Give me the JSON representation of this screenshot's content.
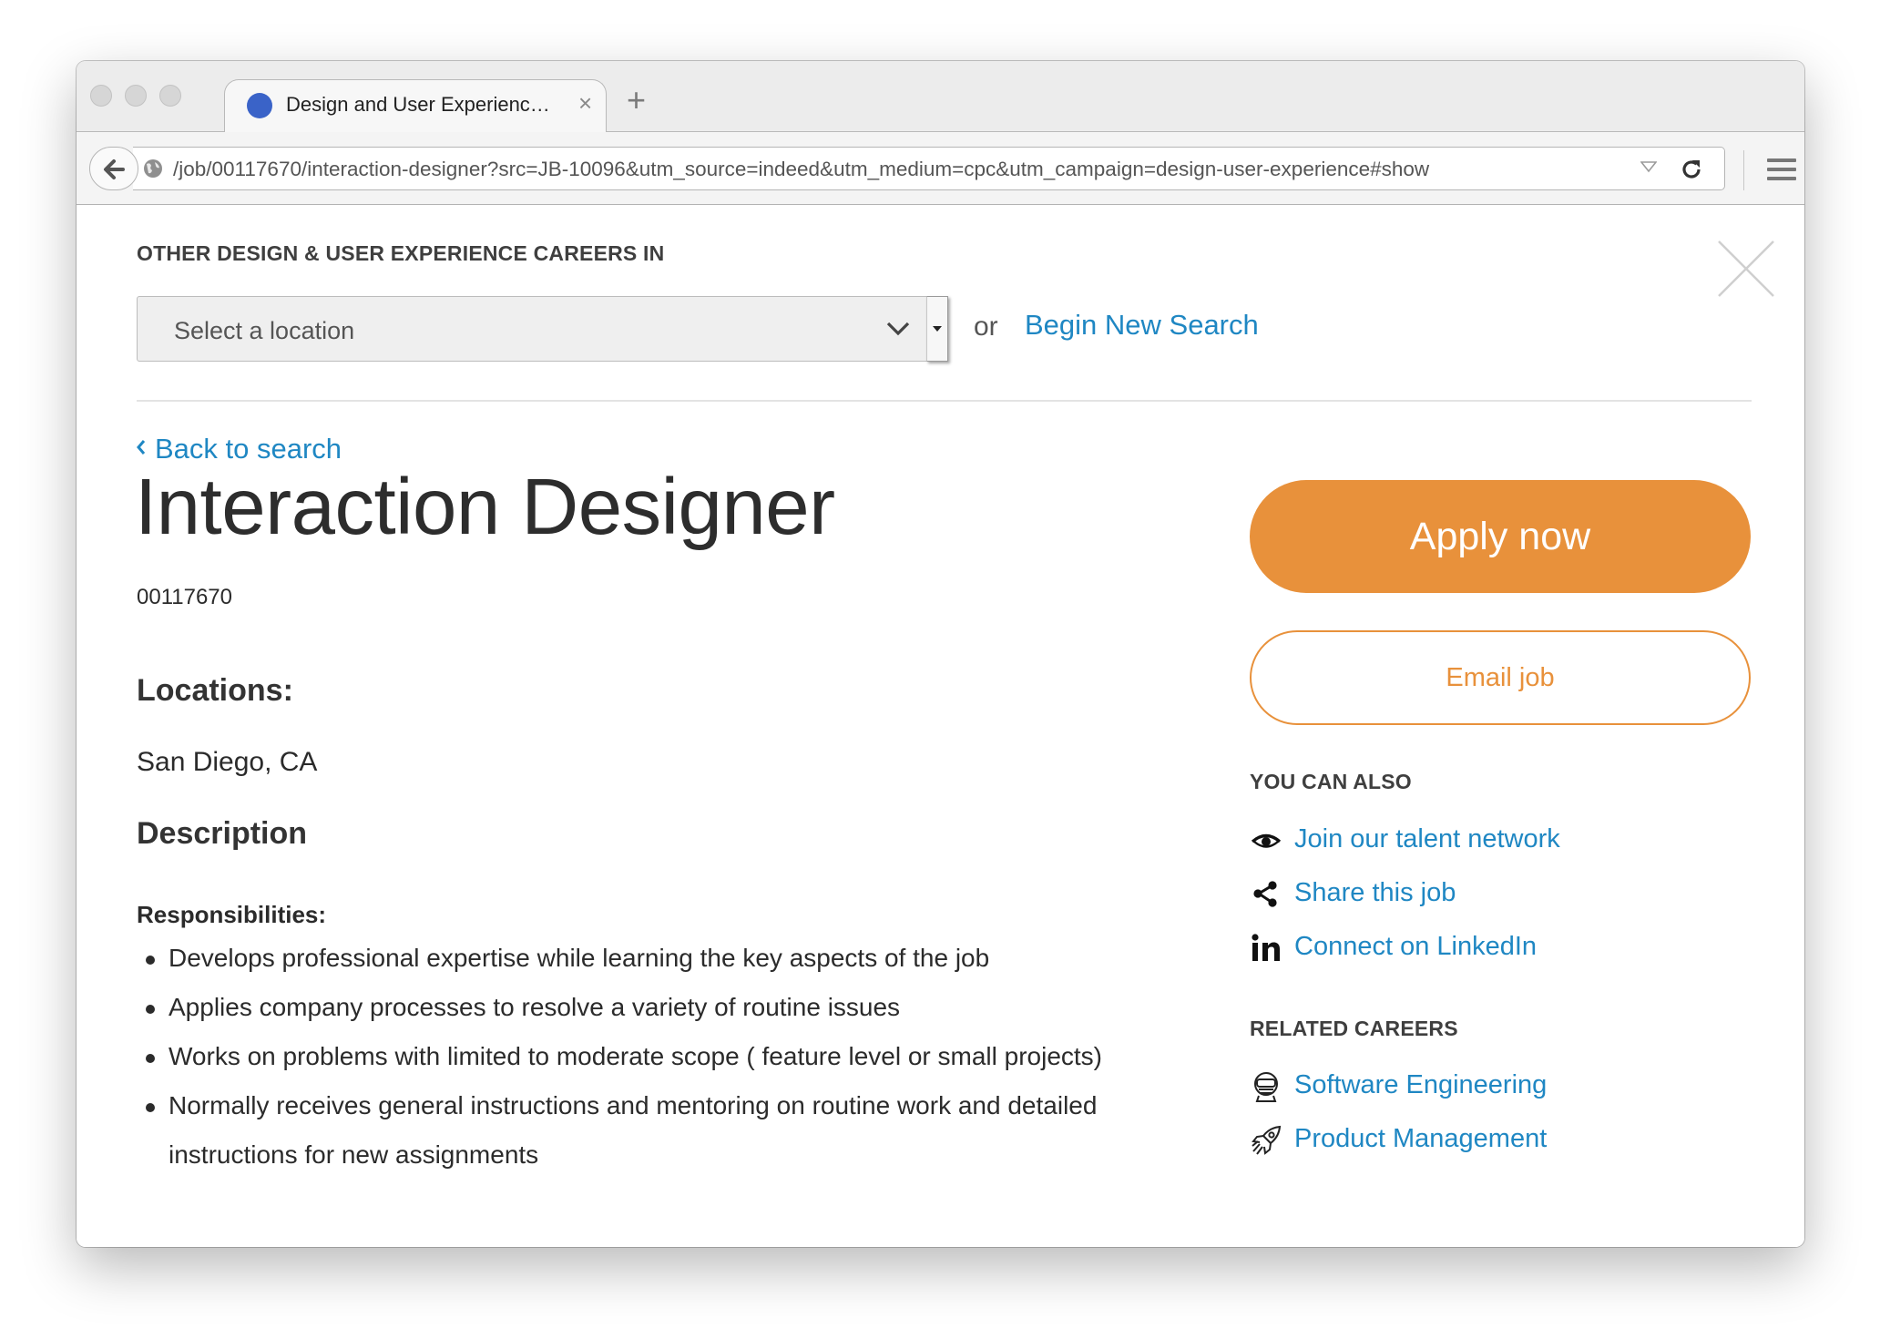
{
  "browser": {
    "tab_title": "Design and User Experienc…",
    "tab_close": "×",
    "new_tab": "+",
    "url": "/job/00117670/interaction-designer?src=JB-10096&utm_source=indeed&utm_medium=cpc&utm_campaign=design-user-experience#show"
  },
  "filter": {
    "heading": "OTHER DESIGN & USER EXPERIENCE CAREERS IN",
    "location_placeholder": "Select a location",
    "or": "or",
    "begin_search": "Begin New Search"
  },
  "job": {
    "back_label": "Back to search",
    "title": "Interaction Designer",
    "id": "00117670",
    "locations_heading": "Locations:",
    "location": "San Diego, CA",
    "description_heading": "Description",
    "responsibilities_heading": "Responsibilities:",
    "responsibilities": [
      "Develops professional expertise while learning the key aspects of the job",
      "Applies company processes to resolve a variety of routine issues",
      "Works on problems with limited to moderate scope ( feature level or small projects)",
      "Normally receives general instructions and mentoring on routine work and detailed instructions for new assignments"
    ]
  },
  "sidebar": {
    "apply_label": "Apply now",
    "email_label": "Email job",
    "also_heading": "YOU CAN ALSO",
    "also_links": [
      {
        "label": "Join our talent network",
        "icon": "eye-icon"
      },
      {
        "label": "Share this job",
        "icon": "share-icon"
      },
      {
        "label": "Connect on LinkedIn",
        "icon": "linkedin-icon"
      }
    ],
    "related_heading": "RELATED CAREERS",
    "related_links": [
      {
        "label": "Software Engineering",
        "icon": "robot-icon"
      },
      {
        "label": "Product Management",
        "icon": "rocket-icon"
      }
    ]
  },
  "colors": {
    "accent_orange": "#e8913b",
    "link_blue": "#1f87c3",
    "favicon_blue": "#3a63c8"
  }
}
